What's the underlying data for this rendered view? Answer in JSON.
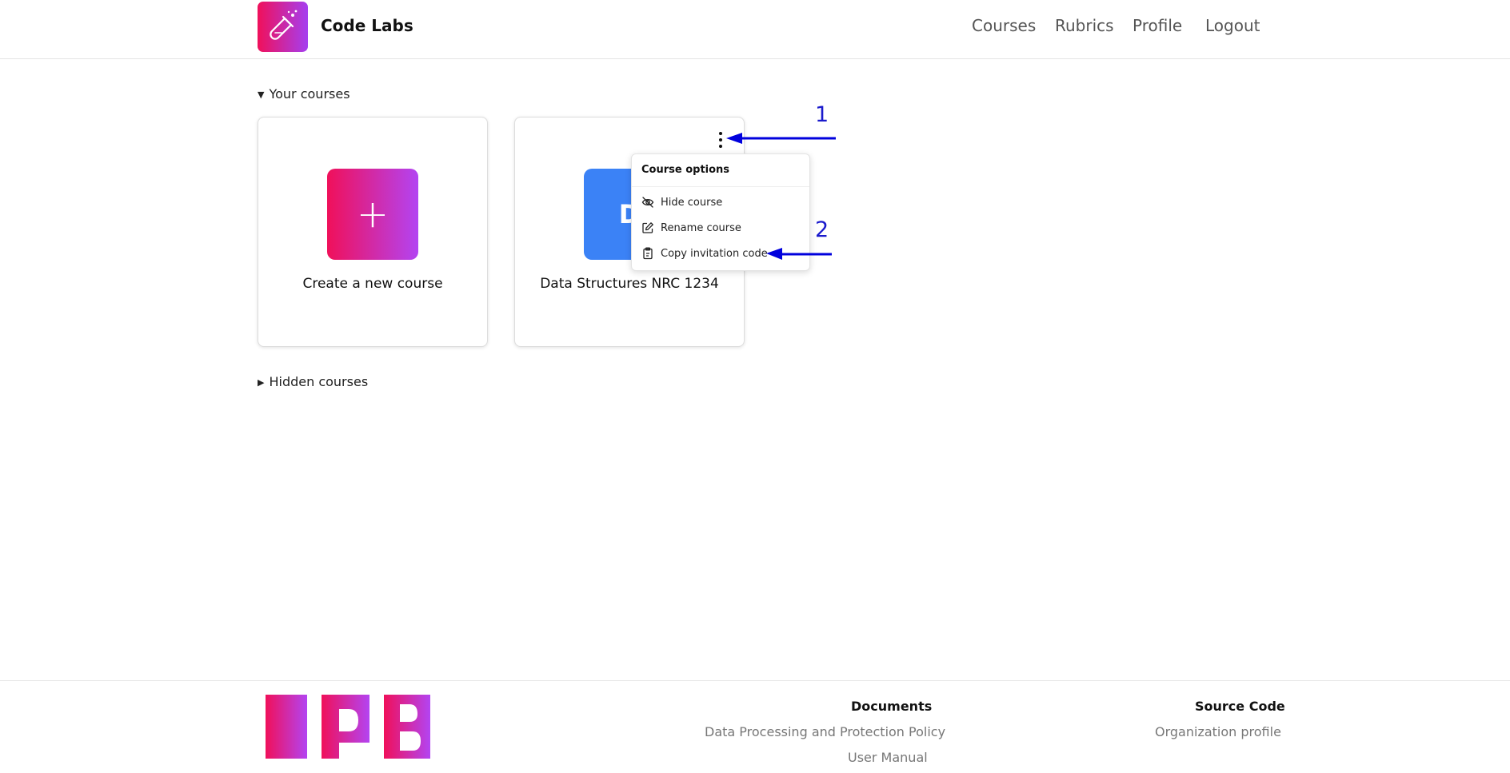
{
  "header": {
    "brand": "Code Labs",
    "nav": [
      "Courses",
      "Rubrics",
      "Profile",
      "Logout"
    ]
  },
  "sections": {
    "your_courses": "Your courses",
    "hidden_courses": "Hidden courses"
  },
  "cards": {
    "create_label": "Create a new course",
    "create_symbol": "+",
    "course_label": "Data Structures NRC 1234",
    "course_initial": "D",
    "course_color": "#3b82f6"
  },
  "menu": {
    "title": "Course options",
    "items": [
      "Hide course",
      "Rename course",
      "Copy invitation code"
    ]
  },
  "annotations": [
    "1",
    "2"
  ],
  "footer": {
    "logo_text": "UPB",
    "documents": {
      "heading": "Documents",
      "links": [
        "Data Processing and Protection Policy",
        "User Manual"
      ]
    },
    "source": {
      "heading": "Source Code",
      "links": [
        "Organization profile"
      ]
    }
  },
  "colors": {
    "brand_start": "#f0105a",
    "brand_end": "#a53ff0",
    "annotation": "#0000dd"
  }
}
